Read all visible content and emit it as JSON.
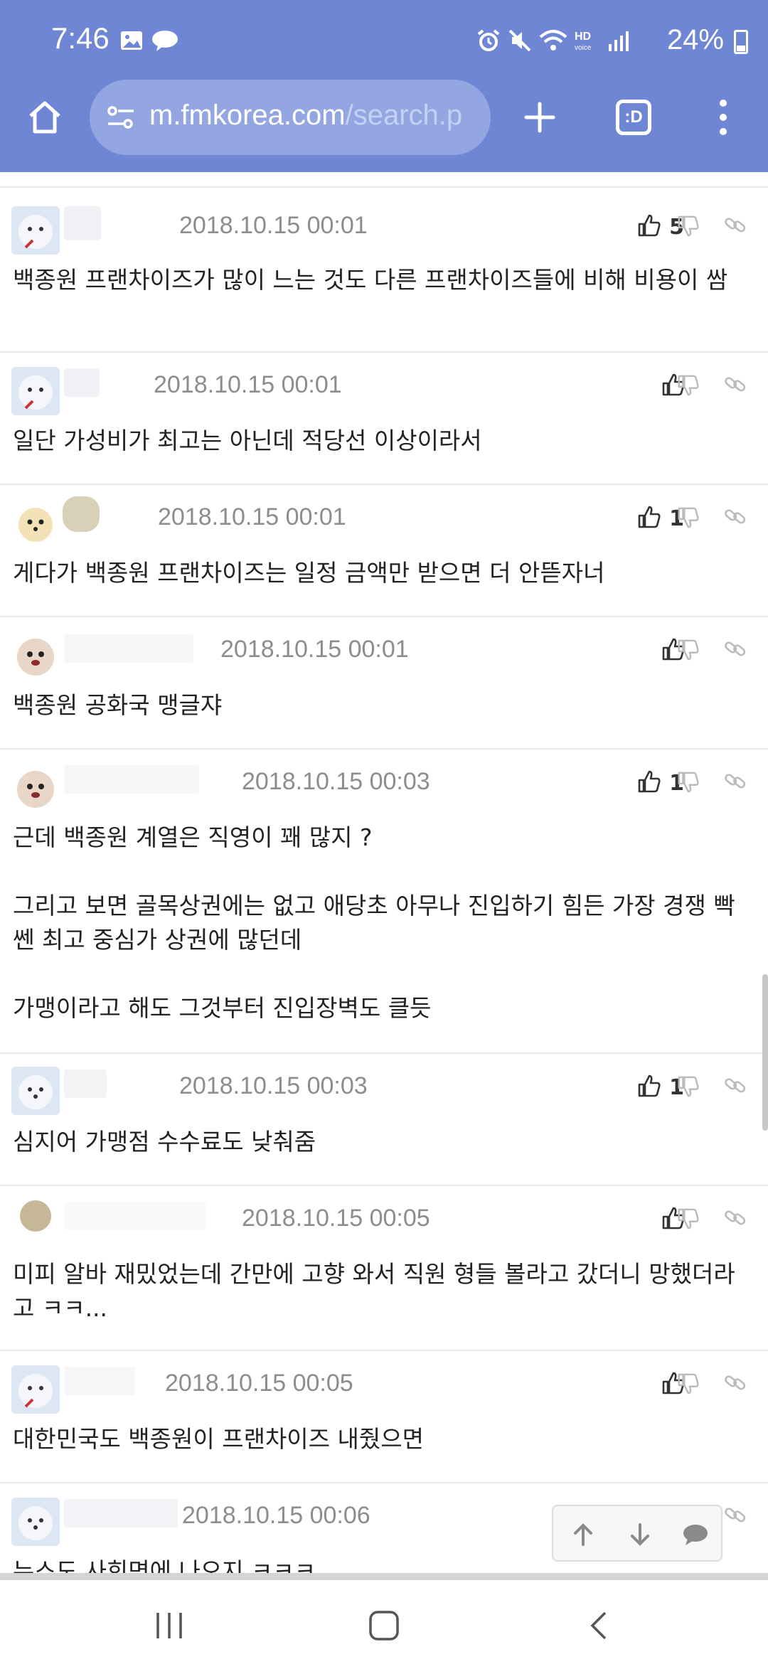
{
  "status_bar": {
    "time": "7:46",
    "battery": "24%"
  },
  "browser": {
    "url_main": "m.fmkorea.com",
    "url_rest": "/search.p",
    "tab_label": ":D"
  },
  "comments": [
    {
      "date": "2018.10.15 00:01",
      "votes": "5",
      "text": "백종원 프랜차이즈가 많이 느는 것도 다른 프랜차이즈들에 비해 비용이 쌈"
    },
    {
      "date": "2018.10.15 00:01",
      "votes": "",
      "text": "일단 가성비가 최고는 아닌데 적당선 이상이라서"
    },
    {
      "date": "2018.10.15 00:01",
      "votes": "1",
      "text": "게다가 백종원 프랜차이즈는 일정 금액만 받으면 더 안뜯자너"
    },
    {
      "date": "2018.10.15 00:01",
      "votes": "",
      "text": "백종원 공화국 맹글쟈"
    },
    {
      "date": "2018.10.15 00:03",
      "votes": "1",
      "text": "근데 백종원 계열은 직영이 꽤 많지 ?\n\n그리고 보면 골목상권에는 없고 애당초 아무나 진입하기 힘든 가장 경쟁 빡쎈 최고 중심가 상권에 많던데\n\n가맹이라고 해도 그것부터 진입장벽도 클듯"
    },
    {
      "date": "2018.10.15 00:03",
      "votes": "1",
      "text": "심지어 가맹점 수수료도 낮춰줌"
    },
    {
      "date": "2018.10.15 00:05",
      "votes": "",
      "text": "미피 알바 재밌었는데 간만에 고향 와서 직원 형들 볼라고 갔더니 망했더라고 ㅋㅋ..."
    },
    {
      "date": "2018.10.15 00:05",
      "votes": "",
      "text": "대한민국도 백종원이 프랜차이즈 내줬으면"
    },
    {
      "date": "2018.10.15 00:06",
      "votes": "",
      "text": "뉴스도 사회면에 나오지 ㅋㅋㅋ"
    }
  ]
}
